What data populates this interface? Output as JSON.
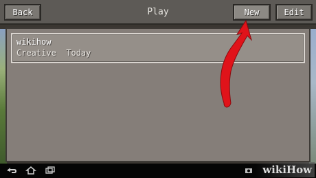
{
  "topbar": {
    "back_label": "Back",
    "title": "Play",
    "new_label": "New",
    "edit_label": "Edit"
  },
  "worlds": [
    {
      "name": "wikihow",
      "meta": "Creative  Today"
    }
  ],
  "watermark": {
    "text": "wikiHow"
  },
  "colors": {
    "arrow": "#e0131a",
    "panel": "#857e79",
    "button": "#7b7873"
  },
  "icons": {
    "nav_back": "back-icon",
    "nav_home": "home-icon",
    "nav_recent": "recent-apps-icon",
    "status": "camera-icon",
    "annotation": "red-arrow-icon"
  }
}
